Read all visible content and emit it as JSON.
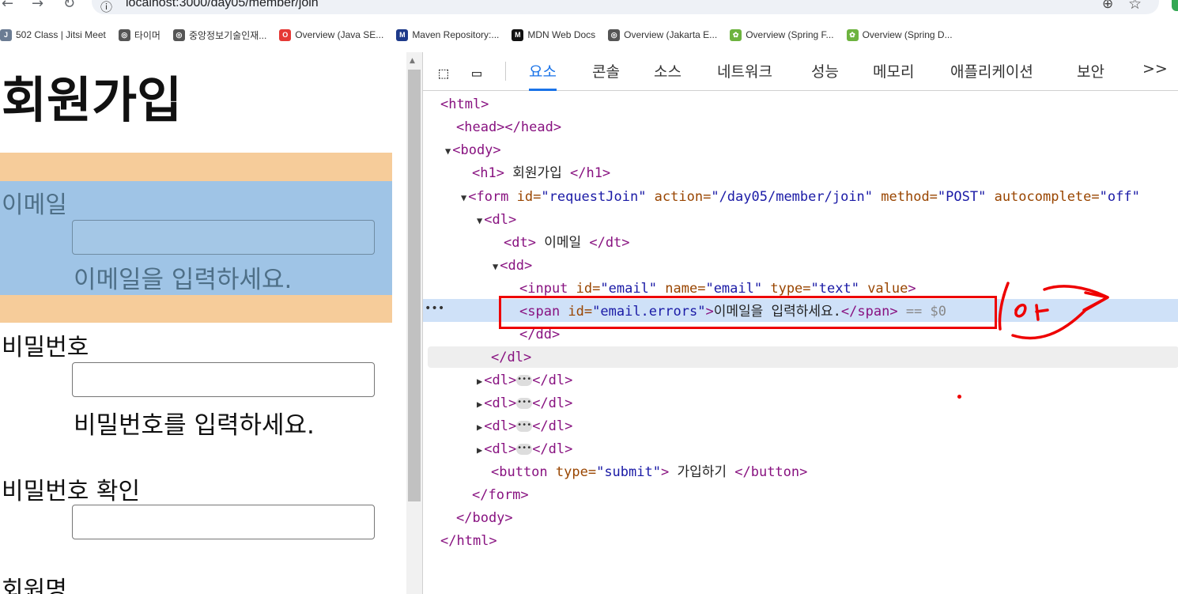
{
  "browser": {
    "url": "localhost:3000/day05/member/join",
    "bookmarks": [
      {
        "icon": "jitsi-icon",
        "label": "502 Class | Jitsi Meet",
        "color": "#6b7c93"
      },
      {
        "icon": "globe-icon",
        "label": "타이머",
        "color": "#555555"
      },
      {
        "icon": "globe-icon",
        "label": "중앙정보기술인재...",
        "color": "#555555"
      },
      {
        "icon": "oracle-icon",
        "label": "Overview (Java SE...",
        "color": "#e53935"
      },
      {
        "icon": "mvn-icon",
        "label": "Maven Repository:...",
        "color": "#1e3a8a"
      },
      {
        "icon": "mdn-icon",
        "label": "MDN Web Docs",
        "color": "#111111"
      },
      {
        "icon": "globe-icon",
        "label": "Overview (Jakarta E...",
        "color": "#555555"
      },
      {
        "icon": "spring-icon",
        "label": "Overview (Spring F...",
        "color": "#6db33f"
      },
      {
        "icon": "spring-icon",
        "label": "Overview (Spring D...",
        "color": "#6db33f"
      }
    ]
  },
  "page": {
    "title": "회원가입",
    "email_label": "이메일",
    "email_error": "이메일을 입력하세요.",
    "password_label": "비밀번호",
    "password_error": "비밀번호를 입력하세요.",
    "password_confirm_label": "비밀번호 확인",
    "name_label": "회원명"
  },
  "devtools": {
    "tabs": [
      "요소",
      "콘솔",
      "소스",
      "네트워크",
      "성능",
      "메모리",
      "애플리케이션",
      "보안"
    ],
    "active_tab": "요소",
    "more_tabs": ">>",
    "dom": {
      "html_open": "<html>",
      "head": "<head></head>",
      "body_open": "<body>",
      "h1_open": "<h1>",
      "h1_text": " 회원가입 ",
      "h1_close": "</h1>",
      "form_open": "<form",
      "form_id_attr": " id=",
      "form_id_val": "\"requestJoin\"",
      "form_action_attr": " action=",
      "form_action_val": "\"/day05/member/join\"",
      "form_method_attr": " method=",
      "form_method_val": "\"POST\"",
      "form_ac_attr": " autocomplete=",
      "form_ac_val": "\"off\"",
      "dl_open": "<dl>",
      "dt_open": "<dt>",
      "dt_text": " 이메일 ",
      "dt_close": "</dt>",
      "dd_open": "<dd>",
      "input_open": "<input",
      "input_id_attr": " id=",
      "input_id_val": "\"email\"",
      "input_name_attr": " name=",
      "input_name_val": "\"email\"",
      "input_type_attr": " type=",
      "input_type_val": "\"text\"",
      "input_value_attr": " value",
      "input_close": ">",
      "span_open": "<span",
      "span_id_attr": " id=",
      "span_id_val": "\"email.errors\"",
      "span_gt": ">",
      "span_text": "이메일을 입력하세요.",
      "span_close": "</span>",
      "span_eq": " == $0",
      "dd_close": "</dd>",
      "dl_close": "</dl>",
      "collapsed_dl_open": "<dl>",
      "collapsed_dl_close": "</dl>",
      "button_open": "<button",
      "button_type_attr": " type=",
      "button_type_val": "\"submit\"",
      "button_gt": ">",
      "button_text": " 가입하기 ",
      "button_close": "</button>",
      "form_close": "</form>",
      "body_close": "</body>",
      "html_close": "</html>"
    }
  },
  "annotation": {
    "handwriting": "이거"
  }
}
